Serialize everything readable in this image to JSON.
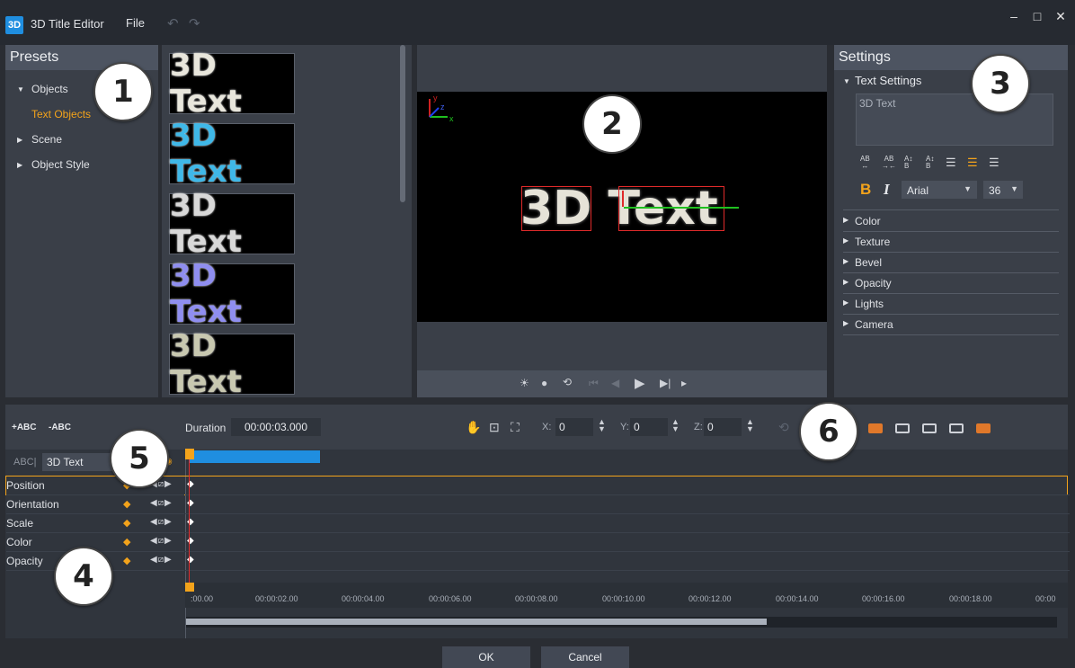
{
  "app": {
    "logo": "3D",
    "title": "3D Title Editor",
    "menu": [
      "File"
    ],
    "undo_icon": "↶",
    "redo_icon": "↷"
  },
  "window": {
    "minimize": "–",
    "maximize": "□",
    "close": "✕"
  },
  "presets": {
    "header": "Presets",
    "tree": [
      {
        "label": "Objects",
        "expanded": true
      },
      {
        "label": "Text Objects",
        "selected": true
      },
      {
        "label": "Scene",
        "expanded": false
      },
      {
        "label": "Object Style",
        "expanded": false
      }
    ],
    "thumbnails": [
      {
        "text": "3D Text",
        "color": "#e8e6dc"
      },
      {
        "text": "3D Text",
        "color": "#3fb8e8"
      },
      {
        "text": "3D Text",
        "color": "#d8d8d8"
      },
      {
        "text": "3D Text",
        "color": "#8f8ef0"
      },
      {
        "text": "3D Text",
        "color": "#c8c8b0"
      }
    ]
  },
  "preview": {
    "text": "3D Text",
    "axes": {
      "x": "x",
      "y": "y",
      "z": "z"
    },
    "controls": [
      "☀",
      "●",
      "⟲",
      "⏮",
      "◀",
      "▶",
      "▶|",
      "▸"
    ]
  },
  "settings": {
    "header": "Settings",
    "text_settings_label": "Text Settings",
    "text_value": "3D Text",
    "bold": "B",
    "italic": "I",
    "font": "Arial",
    "size": "36",
    "sections": [
      "Color",
      "Texture",
      "Bevel",
      "Opacity",
      "Lights",
      "Camera"
    ]
  },
  "timeline": {
    "add_text": "+ABC",
    "remove_text": "-ABC",
    "duration_label": "Duration",
    "duration_value": "00:00:03.000",
    "x_label": "X:",
    "x_value": "0",
    "y_label": "Y:",
    "y_value": "0",
    "z_label": "Z:",
    "z_value": "0",
    "track_icon": "ABC|",
    "track_name": "3D Text",
    "properties": [
      "Position",
      "Orientation",
      "Scale",
      "Color",
      "Opacity"
    ],
    "ticks": [
      ":00.00",
      "00:00:02.00",
      "00:00:04.00",
      "00:00:06.00",
      "00:00:08.00",
      "00:00:10.00",
      "00:00:12.00",
      "00:00:14.00",
      "00:00:16.00",
      "00:00:18.00",
      "00:00"
    ]
  },
  "callouts": [
    "1",
    "2",
    "3",
    "4",
    "5",
    "6"
  ],
  "buttons": {
    "ok": "OK",
    "cancel": "Cancel"
  },
  "colors": {
    "accent": "#f3a31b",
    "clip": "#1f8ee0",
    "playhead": "#e02a2a"
  }
}
